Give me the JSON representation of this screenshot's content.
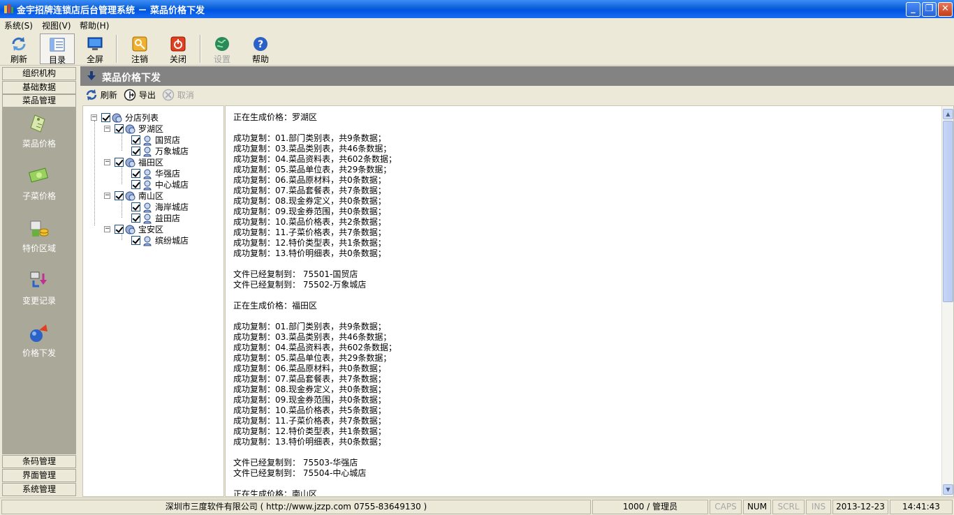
{
  "window": {
    "title": "金宇招牌连锁店后台管理系统 － 菜品价格下发"
  },
  "menu": [
    "系统(S)",
    "视图(V)",
    "帮助(H)"
  ],
  "toolbar": {
    "refresh": "刷新",
    "catalog": "目录",
    "fullscreen": "全屏",
    "logout": "注销",
    "close": "关闭",
    "settings": "设置",
    "help": "帮助"
  },
  "nav": {
    "headers_top": [
      "组织机构",
      "基础数据",
      "菜品管理"
    ],
    "items": [
      "菜品价格",
      "子菜价格",
      "特价区域",
      "变更记录",
      "价格下发"
    ],
    "headers_bottom": [
      "条码管理",
      "界面管理",
      "系统管理"
    ]
  },
  "panel": {
    "title": "菜品价格下发",
    "refresh": "刷新",
    "export": "导出",
    "cancel": "取消"
  },
  "tree": {
    "root": "分店列表",
    "groups": [
      {
        "label": "罗湖区",
        "children": [
          "国贸店",
          "万象城店"
        ]
      },
      {
        "label": "福田区",
        "children": [
          "华强店",
          "中心城店"
        ]
      },
      {
        "label": "南山区",
        "children": [
          "海岸城店",
          "益田店"
        ]
      },
      {
        "label": "宝安区",
        "children": [
          "缤纷城店"
        ]
      }
    ]
  },
  "log_lines": [
    "正在生成价格：罗湖区",
    "",
    "成功复制：01.部门类别表，共9条数据；",
    "成功复制：03.菜品类别表，共46条数据；",
    "成功复制：04.菜品资料表，共602条数据；",
    "成功复制：05.菜品单位表，共29条数据；",
    "成功复制：06.菜品原材料，共0条数据；",
    "成功复制：07.菜品套餐表，共7条数据；",
    "成功复制：08.现金券定义，共0条数据；",
    "成功复制：09.现金券范围，共0条数据；",
    "成功复制：10.菜品价格表，共2条数据；",
    "成功复制：11.子菜价格表，共7条数据；",
    "成功复制：12.特价类型表，共1条数据；",
    "成功复制：13.特价明细表，共0条数据；",
    "",
    "文件已经复制到： 75501-国贸店",
    "文件已经复制到： 75502-万象城店",
    "",
    "正在生成价格：福田区",
    "",
    "成功复制：01.部门类别表，共9条数据；",
    "成功复制：03.菜品类别表，共46条数据；",
    "成功复制：04.菜品资料表，共602条数据；",
    "成功复制：05.菜品单位表，共29条数据；",
    "成功复制：06.菜品原材料，共0条数据；",
    "成功复制：07.菜品套餐表，共7条数据；",
    "成功复制：08.现金券定义，共0条数据；",
    "成功复制：09.现金券范围，共0条数据；",
    "成功复制：10.菜品价格表，共5条数据；",
    "成功复制：11.子菜价格表，共7条数据；",
    "成功复制：12.特价类型表，共1条数据；",
    "成功复制：13.特价明细表，共0条数据；",
    "",
    "文件已经复制到： 75503-华强店",
    "文件已经复制到： 75504-中心城店",
    "",
    "正在生成价格：南山区"
  ],
  "status": {
    "company": "深圳市三度软件有限公司 ( http://www.jzzp.com   0755-83649130 )",
    "user": "1000 / 管理员",
    "caps": "CAPS",
    "num": "NUM",
    "scrl": "SCRL",
    "ins": "INS",
    "date": "2013-12-23",
    "time": "14:41:43"
  },
  "colors": {
    "titlebar": "#0054e3",
    "panel_header": "#838383",
    "nav_panel": "#a9a899",
    "background": "#ece9d8"
  }
}
